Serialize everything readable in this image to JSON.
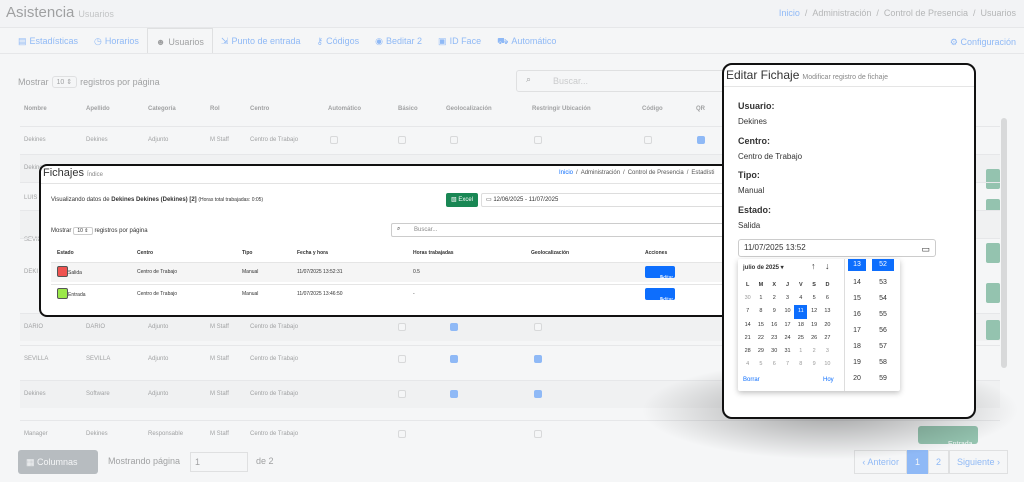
{
  "bg": {
    "app_title": "Asistencia",
    "app_subtitle": "Usuarios",
    "breadcrumb": [
      "Inicio",
      "/",
      "Administración",
      "/",
      "Control de Presencia",
      "/",
      "Usuarios"
    ],
    "tabs": [
      {
        "icon": "chart-icon",
        "label": "Estadísticas"
      },
      {
        "icon": "clock-icon",
        "label": "Horarios"
      },
      {
        "icon": "users-icon",
        "label": "Usuarios"
      },
      {
        "icon": "entry-icon",
        "label": "Punto de entrada"
      },
      {
        "icon": "key-icon",
        "label": "Códigos"
      },
      {
        "icon": "wifi-icon",
        "label": "Beditar 2"
      },
      {
        "icon": "face-icon",
        "label": "ID Face"
      },
      {
        "icon": "car-icon",
        "label": "Automático"
      }
    ],
    "config_label": "Configuración",
    "show_label": "Mostrar",
    "show_value": "10",
    "per_page_label": "registros por página",
    "search_placeholder": "Buscar...",
    "columns": [
      "Nombre",
      "Apellido",
      "Categoría",
      "Rol",
      "Centro",
      "Automático",
      "Básico",
      "Geolocalización",
      "Restringir Ubicación",
      "Código",
      "QR"
    ],
    "rows": [
      {
        "nombre": "Dekines",
        "apellido": "Dekines",
        "categoria": "Adjunto",
        "rol": "M Staff",
        "centro": "Centro de Trabajo"
      },
      {
        "nombre": "Dekines",
        "apellido": "",
        "categoria": "",
        "rol": "",
        "centro": ""
      },
      {
        "nombre": "LUIS",
        "apellido": "",
        "categoria": "",
        "rol": "",
        "centro": ""
      },
      {
        "nombre": "SEVILLA",
        "apellido": "",
        "categoria": "",
        "rol": "",
        "centro": ""
      },
      {
        "nombre": "DEKI",
        "apellido": "",
        "categoria": "",
        "rol": "",
        "centro": ""
      },
      {
        "nombre": "DARIO",
        "apellido": "DARIO",
        "categoria": "Adjunto",
        "rol": "M Staff",
        "centro": "Centro de Trabajo"
      },
      {
        "nombre": "SEVILLA",
        "apellido": "SEVILLA",
        "categoria": "Adjunto",
        "rol": "M Staff",
        "centro": "Centro de Trabajo"
      },
      {
        "nombre": "Dekines",
        "apellido": "Software",
        "categoria": "Adjunto",
        "rol": "M Staff",
        "centro": "Centro de Trabajo"
      },
      {
        "nombre": "Manager",
        "apellido": "Dekines",
        "categoria": "Responsable",
        "rol": "M Staff",
        "centro": "Centro de Trabajo"
      }
    ],
    "row_button_label": "Entrada",
    "columns_button": "Columnas",
    "showing_page_label": "Mostrando página",
    "page_value": "1",
    "of_label": "de 2",
    "prev_label": "‹ Anterior",
    "pages": [
      "1",
      "2"
    ],
    "next_label": "Siguiente ›"
  },
  "fichajes": {
    "title": "Fichajes",
    "subtitle": "Índice",
    "breadcrumb": [
      "Inicio",
      "/",
      "Administración",
      "/",
      "Control de Presencia",
      "/",
      "Estadísti"
    ],
    "viewing_prefix": "Visualizando datos de",
    "viewing_user": "Dekines Dekines (Dekines) [2]",
    "hours_note": "(Horas total trabajadas: 0:05)",
    "excel_label": "Excel",
    "date_range": "12/06/2025 - 11/07/2025",
    "show_label": "Mostrar",
    "show_value": "10",
    "per_page_label": "registros por página",
    "search_placeholder": "Buscar...",
    "columns": [
      "Estado",
      "Centro",
      "Tipo",
      "Fecha y hora",
      "Horas trabajadas",
      "Geolocalización",
      "Acciones"
    ],
    "rows": [
      {
        "estado": "Salida",
        "color": "#ef5350",
        "centro": "Centro de Trabajo",
        "tipo": "Manual",
        "fecha": "11/07/2025 13:52:31",
        "horas": "0.5",
        "geo": "",
        "accion": "Editar"
      },
      {
        "estado": "Entrada",
        "color": "#9be84a",
        "centro": "Centro de Trabajo",
        "tipo": "Manual",
        "fecha": "11/07/2025 13:46:50",
        "horas": "-",
        "geo": "",
        "accion": "Editar"
      }
    ]
  },
  "editar": {
    "title": "Editar Fichaje",
    "subtitle": "Modificar registro de fichaje",
    "usuario_label": "Usuario:",
    "usuario_value": "Dekines",
    "centro_label": "Centro:",
    "centro_value": "Centro de Trabajo",
    "tipo_label": "Tipo:",
    "tipo_value": "Manual",
    "estado_label": "Estado:",
    "estado_value": "Salida",
    "datetime_value": "11/07/2025 13:52",
    "calendar": {
      "month_label": "julio de 2025",
      "weekday_headers": [
        "L",
        "M",
        "X",
        "J",
        "V",
        "S",
        "D"
      ],
      "weeks": [
        [
          "30",
          "1",
          "2",
          "3",
          "4",
          "5",
          "6"
        ],
        [
          "7",
          "8",
          "9",
          "10",
          "11",
          "12",
          "13"
        ],
        [
          "14",
          "15",
          "16",
          "17",
          "18",
          "19",
          "20"
        ],
        [
          "21",
          "22",
          "23",
          "24",
          "25",
          "26",
          "27"
        ],
        [
          "28",
          "29",
          "30",
          "31",
          "1",
          "2",
          "3"
        ],
        [
          "4",
          "5",
          "6",
          "7",
          "8",
          "9",
          "10"
        ]
      ],
      "selected_day": "11",
      "hours": [
        "13",
        "14",
        "15",
        "16",
        "17",
        "18",
        "19",
        "20"
      ],
      "minutes": [
        "52",
        "53",
        "54",
        "55",
        "56",
        "57",
        "58",
        "59"
      ],
      "selected_hour": "13",
      "selected_minute": "52",
      "clear_label": "Borrar",
      "today_label": "Hoy"
    }
  }
}
